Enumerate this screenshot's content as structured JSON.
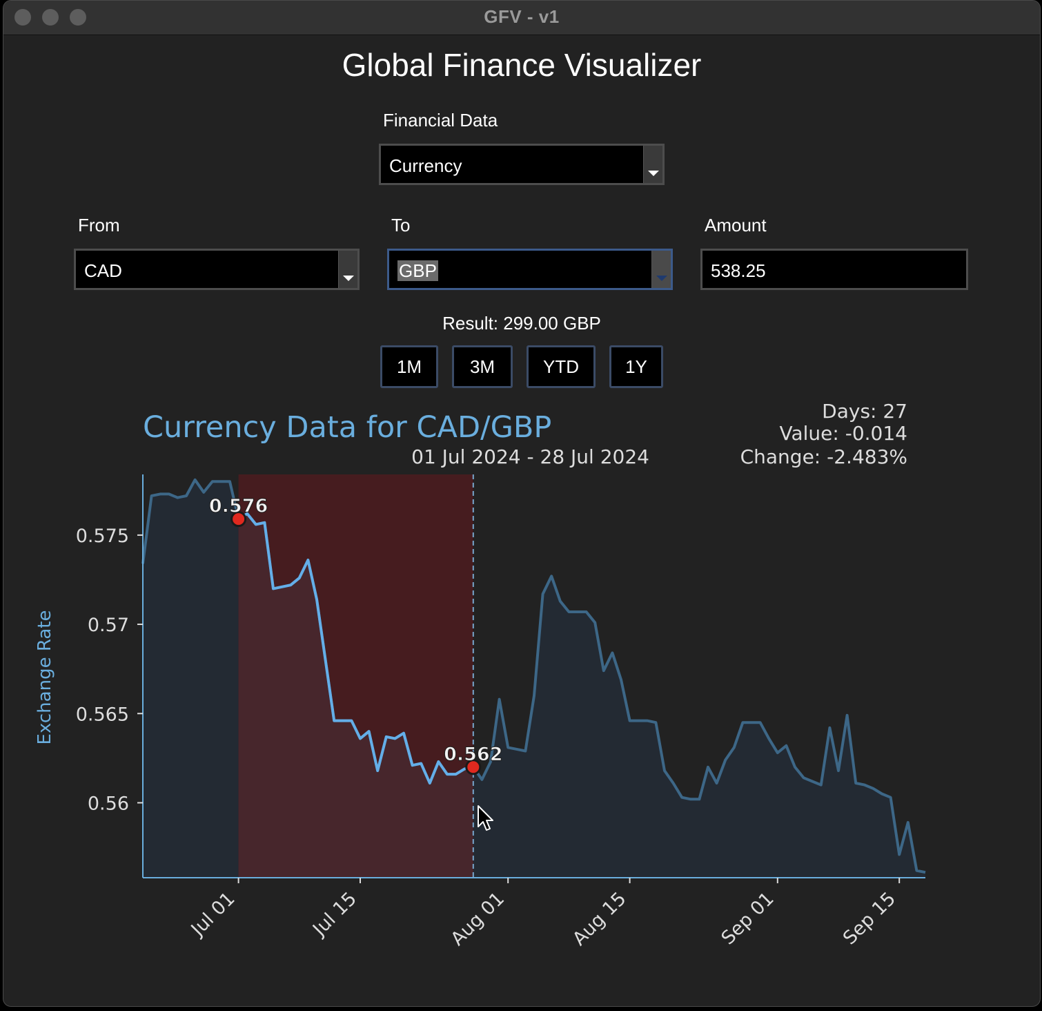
{
  "window": {
    "title": "GFV - v1"
  },
  "app_title": "Global Finance Visualizer",
  "financial_data": {
    "label": "Financial Data",
    "selected": "Currency"
  },
  "from": {
    "label": "From",
    "selected": "CAD"
  },
  "to": {
    "label": "To",
    "selected": "GBP"
  },
  "amount": {
    "label": "Amount",
    "value": "538.25"
  },
  "result": "Result: 299.00 GBP",
  "range_buttons": [
    "1M",
    "3M",
    "YTD",
    "1Y"
  ],
  "chart_data": {
    "type": "line",
    "title": "Currency Data for CAD/GBP",
    "subtitle": "01 Jul 2024 - 28 Jul 2024",
    "stats": {
      "days": "Days: 27",
      "value": "Value: -0.014",
      "change": "Change: -2.483%"
    },
    "ylabel": "Exchange Rate",
    "ylim": [
      0.5558,
      0.5784
    ],
    "xlim": [
      "2024-06-20",
      "2024-09-18"
    ],
    "yticks": [
      0.575,
      0.57,
      0.565,
      0.56
    ],
    "ytick_labels": [
      "0.575",
      "0.57",
      "0.565",
      "0.56"
    ],
    "xticks": [
      "2024-07-01",
      "2024-07-15",
      "2024-08-01",
      "2024-08-15",
      "2024-09-01",
      "2024-09-15"
    ],
    "xtick_labels": [
      "Jul 01",
      "Jul 15",
      "Aug 01",
      "Aug 15",
      "Sep 01",
      "Sep 15"
    ],
    "highlight_range": [
      "2024-07-01",
      "2024-07-28"
    ],
    "cursor_date": "2024-07-28",
    "markers": [
      {
        "date": "2024-07-01",
        "value": 0.5759,
        "label": "0.576"
      },
      {
        "date": "2024-07-28",
        "value": 0.562,
        "label": "0.562"
      }
    ],
    "series": [
      {
        "x": [
          "2024-06-20",
          "2024-06-21",
          "2024-06-22",
          "2024-06-23",
          "2024-06-24",
          "2024-06-25",
          "2024-06-26",
          "2024-06-27",
          "2024-06-28",
          "2024-06-29",
          "2024-06-30",
          "2024-07-01",
          "2024-07-02",
          "2024-07-03",
          "2024-07-04",
          "2024-07-05",
          "2024-07-06",
          "2024-07-07",
          "2024-07-08",
          "2024-07-09",
          "2024-07-10",
          "2024-07-11",
          "2024-07-12",
          "2024-07-13",
          "2024-07-14",
          "2024-07-15",
          "2024-07-16",
          "2024-07-17",
          "2024-07-18",
          "2024-07-19",
          "2024-07-20",
          "2024-07-21",
          "2024-07-22",
          "2024-07-23",
          "2024-07-24",
          "2024-07-25",
          "2024-07-26",
          "2024-07-27",
          "2024-07-28",
          "2024-07-29",
          "2024-07-30",
          "2024-07-31",
          "2024-08-01",
          "2024-08-02",
          "2024-08-03",
          "2024-08-04",
          "2024-08-05",
          "2024-08-06",
          "2024-08-07",
          "2024-08-08",
          "2024-08-09",
          "2024-08-10",
          "2024-08-11",
          "2024-08-12",
          "2024-08-13",
          "2024-08-14",
          "2024-08-15",
          "2024-08-16",
          "2024-08-17",
          "2024-08-18",
          "2024-08-19",
          "2024-08-20",
          "2024-08-21",
          "2024-08-22",
          "2024-08-23",
          "2024-08-24",
          "2024-08-25",
          "2024-08-26",
          "2024-08-27",
          "2024-08-28",
          "2024-08-29",
          "2024-08-30",
          "2024-08-31",
          "2024-09-01",
          "2024-09-02",
          "2024-09-03",
          "2024-09-04",
          "2024-09-05",
          "2024-09-06",
          "2024-09-07",
          "2024-09-08",
          "2024-09-09",
          "2024-09-10",
          "2024-09-11",
          "2024-09-12",
          "2024-09-13",
          "2024-09-14",
          "2024-09-15",
          "2024-09-16",
          "2024-09-17",
          "2024-09-18"
        ],
        "values": [
          0.5734,
          0.5772,
          0.5773,
          0.5773,
          0.5771,
          0.5772,
          0.5781,
          0.5774,
          0.578,
          0.578,
          0.578,
          0.5759,
          0.5762,
          0.5756,
          0.5757,
          0.572,
          0.5721,
          0.5722,
          0.5726,
          0.5736,
          0.5714,
          0.568,
          0.5646,
          0.5646,
          0.5646,
          0.5636,
          0.564,
          0.5618,
          0.5637,
          0.5636,
          0.5639,
          0.5621,
          0.5622,
          0.5611,
          0.5623,
          0.5616,
          0.5616,
          0.5619,
          0.562,
          0.5613,
          0.5623,
          0.5658,
          0.5631,
          0.563,
          0.5629,
          0.566,
          0.5717,
          0.5727,
          0.5713,
          0.5707,
          0.5707,
          0.5707,
          0.5701,
          0.5674,
          0.5684,
          0.5669,
          0.5646,
          0.5646,
          0.5646,
          0.5645,
          0.5618,
          0.5611,
          0.5603,
          0.5602,
          0.5602,
          0.562,
          0.5611,
          0.5624,
          0.5631,
          0.5645,
          0.5645,
          0.5645,
          0.5636,
          0.5628,
          0.5632,
          0.562,
          0.5614,
          0.5612,
          0.561,
          0.5642,
          0.5618,
          0.5649,
          0.5611,
          0.561,
          0.5608,
          0.5605,
          0.5603,
          0.5571,
          0.5589,
          0.5562,
          0.5561
        ]
      }
    ]
  }
}
